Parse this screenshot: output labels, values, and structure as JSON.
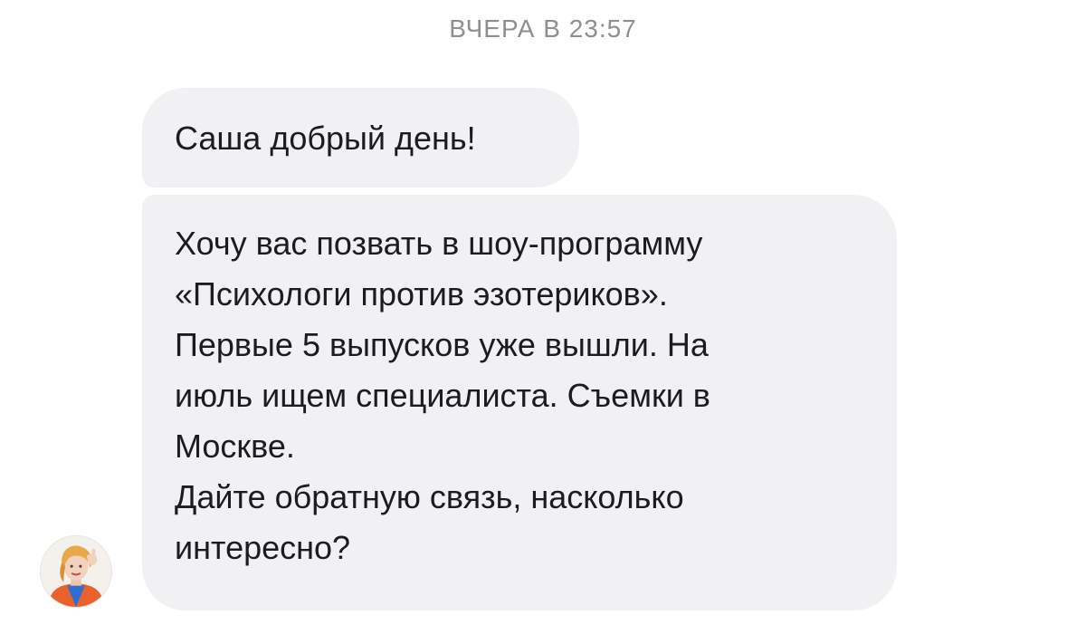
{
  "chat": {
    "timestamp": "ВЧЕРА В 23:57",
    "messages": [
      {
        "lines": [
          "Саша добрый день!"
        ]
      },
      {
        "lines": [
          "Хочу вас позвать в шоу-программу",
          "«Психологи против эзотериков».",
          "Первые 5 выпусков уже вышли. На",
          "июль ищем специалиста. Съемки в",
          "Москве.",
          "Дайте обратную связь, насколько",
          "интересно?"
        ]
      }
    ],
    "sender_avatar": {
      "icon": "user-avatar-photo",
      "colors": {
        "hair": "#e8a84a",
        "skin": "#f3d2bd",
        "jacket": "#e8622c",
        "shirt": "#2d6fd1"
      }
    }
  }
}
